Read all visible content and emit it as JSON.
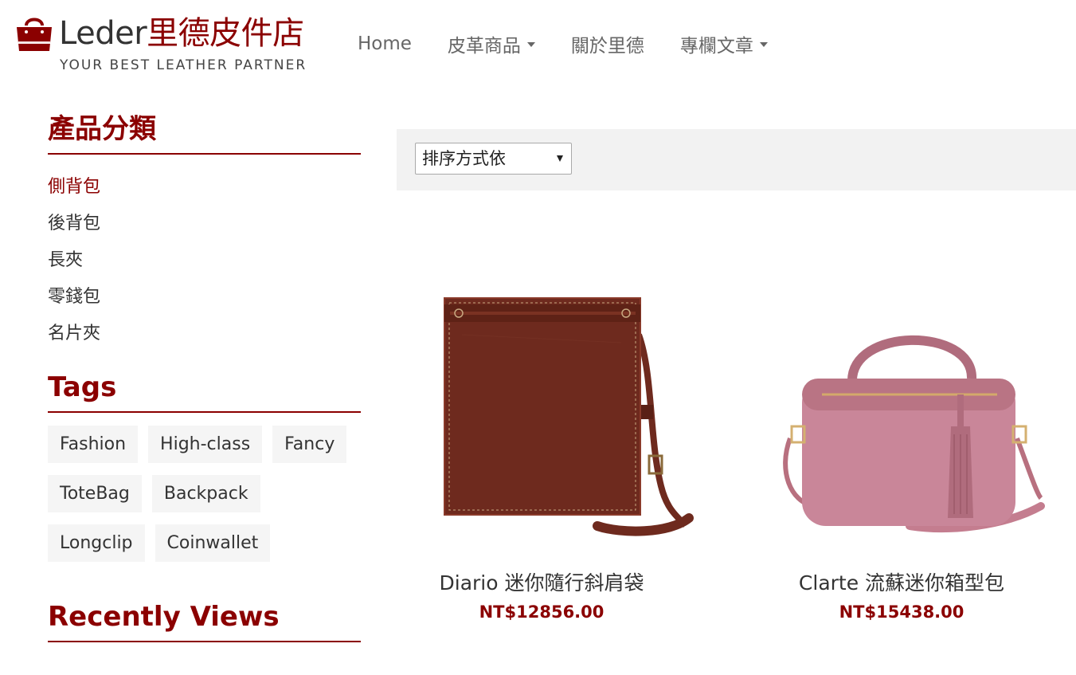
{
  "brand": {
    "name_en": "Leder",
    "name_zh": "里德皮件店",
    "tagline": "YOUR BEST LEATHER PARTNER",
    "accent_color": "#8b0000",
    "icon": "shopping-bag-icon"
  },
  "nav": {
    "items": [
      {
        "label": "Home",
        "dropdown": false
      },
      {
        "label": "皮革商品",
        "dropdown": true
      },
      {
        "label": "關於里德",
        "dropdown": false
      },
      {
        "label": "專欄文章",
        "dropdown": true
      }
    ]
  },
  "sidebar": {
    "categories_heading": "產品分類",
    "categories": [
      "側背包",
      "後背包",
      "長夾",
      "零錢包",
      "名片夾"
    ],
    "active_category": "側背包",
    "tags_heading": "Tags",
    "tags": [
      "Fashion",
      "High-class",
      "Fancy",
      "ToteBag",
      "Backpack",
      "Longclip",
      "Coinwallet"
    ],
    "recent_heading": "Recently Views"
  },
  "sort": {
    "selected": "排序方式依"
  },
  "products": [
    {
      "name": "Diario 迷你隨行斜肩袋",
      "price": "NT$12856.00",
      "color": "#6e2a1e"
    },
    {
      "name": "Clarte 流蘇迷你箱型包",
      "price": "NT$15438.00",
      "color": "#c47d8f"
    }
  ]
}
